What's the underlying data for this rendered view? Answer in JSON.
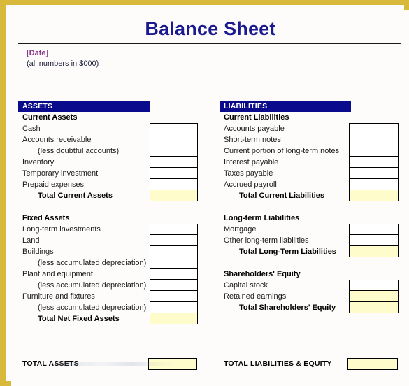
{
  "document": {
    "title": "Balance Sheet",
    "date_placeholder": "[Date]",
    "units_note": "(all numbers in $000)"
  },
  "colors": {
    "frame": "#d9b93c",
    "title": "#1b1b8f",
    "section_bar": "#0a0a8c",
    "date_text": "#8b3a8b",
    "total_fill": "#fffccc",
    "page_background": "#fdfcfa"
  },
  "assets": {
    "header": "ASSETS",
    "groups": [
      {
        "heading": "Current Assets",
        "rows": [
          {
            "label": "Cash",
            "style": "plain",
            "fill": false
          },
          {
            "label": "Accounts receivable",
            "style": "plain",
            "fill": false
          },
          {
            "label": "(less doubtful accounts)",
            "style": "indent",
            "fill": false
          },
          {
            "label": "Inventory",
            "style": "plain",
            "fill": false
          },
          {
            "label": "Temporary investment",
            "style": "plain",
            "fill": false
          },
          {
            "label": "Prepaid expenses",
            "style": "plain",
            "fill": false
          },
          {
            "label": "Total Current Assets",
            "style": "total",
            "fill": true
          }
        ]
      },
      {
        "heading": "Fixed Assets",
        "rows": [
          {
            "label": "Long-term investments",
            "style": "plain",
            "fill": false
          },
          {
            "label": "Land",
            "style": "plain",
            "fill": false
          },
          {
            "label": "Buildings",
            "style": "plain",
            "fill": false
          },
          {
            "label": "(less accumulated depreciation)",
            "style": "indent",
            "fill": false
          },
          {
            "label": "Plant and equipment",
            "style": "plain",
            "fill": false
          },
          {
            "label": "(less accumulated depreciation)",
            "style": "indent",
            "fill": false
          },
          {
            "label": "Furniture and fixtures",
            "style": "plain",
            "fill": false
          },
          {
            "label": "(less accumulated depreciation)",
            "style": "indent",
            "fill": false
          },
          {
            "label": "Total Net Fixed Assets",
            "style": "total",
            "fill": true
          }
        ]
      }
    ]
  },
  "liabilities": {
    "header": "LIABILITIES",
    "groups": [
      {
        "heading": "Current Liabilities",
        "rows": [
          {
            "label": "Accounts payable",
            "style": "plain",
            "fill": false
          },
          {
            "label": "Short-term notes",
            "style": "plain",
            "fill": false
          },
          {
            "label": "Current portion of long-term notes",
            "style": "plain",
            "fill": false
          },
          {
            "label": "Interest payable",
            "style": "plain",
            "fill": false
          },
          {
            "label": "Taxes payable",
            "style": "plain",
            "fill": false
          },
          {
            "label": "Accrued payroll",
            "style": "plain",
            "fill": false
          },
          {
            "label": "Total Current Liabilities",
            "style": "total",
            "fill": true
          }
        ]
      },
      {
        "heading": "Long-term Liabilities",
        "rows": [
          {
            "label": "Mortgage",
            "style": "plain",
            "fill": false
          },
          {
            "label": "Other long-term liabilities",
            "style": "plain",
            "fill": false
          },
          {
            "label": "Total Long-Term Liabilities",
            "style": "total",
            "fill": true
          }
        ]
      },
      {
        "heading": "Shareholders' Equity",
        "rows": [
          {
            "label": "Capital stock",
            "style": "plain",
            "fill": false
          },
          {
            "label": "Retained earnings",
            "style": "plain",
            "fill": true
          },
          {
            "label": "Total Shareholders' Equity",
            "style": "total",
            "fill": true
          }
        ]
      }
    ]
  },
  "grand_totals": {
    "assets_label": "TOTAL ASSETS",
    "liabilities_label": "TOTAL LIABILITIES & EQUITY"
  }
}
